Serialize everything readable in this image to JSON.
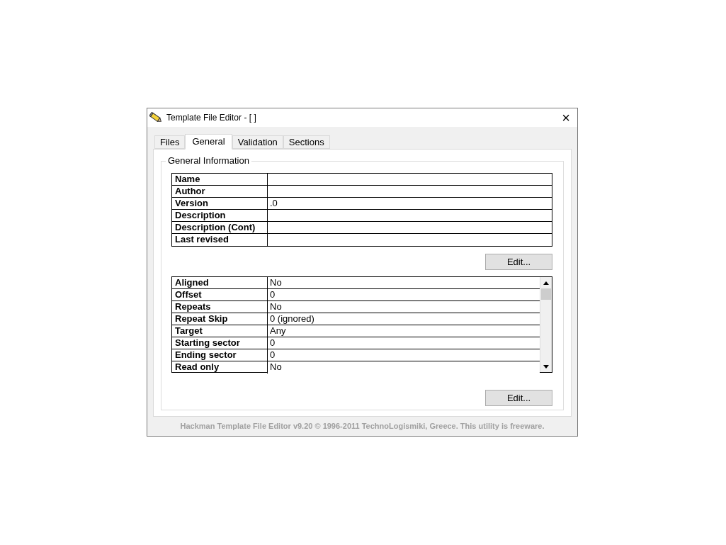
{
  "window": {
    "title": "Template File Editor - [ ]",
    "close": "×"
  },
  "tabs": [
    {
      "label": "Files",
      "selected": false
    },
    {
      "label": "General",
      "selected": true
    },
    {
      "label": "Validation",
      "selected": false
    },
    {
      "label": "Sections",
      "selected": false
    }
  ],
  "group": {
    "title": "General Information"
  },
  "info_table": [
    {
      "label": "Name"
    },
    {
      "label": "Author"
    },
    {
      "label": "Version",
      "value": ".0"
    },
    {
      "label": "Description"
    },
    {
      "label": "Description (Cont)"
    },
    {
      "label": "Last revised"
    }
  ],
  "info_edit_button": "Edit...",
  "properties_table": [
    {
      "label": "Aligned",
      "value": "No"
    },
    {
      "label": "Offset",
      "value": "0"
    },
    {
      "label": "Repeats",
      "value": "No"
    },
    {
      "label": "Repeat Skip",
      "value": "0 (ignored)"
    },
    {
      "label": "Target",
      "value": "Any"
    },
    {
      "label": "Starting sector",
      "value": "0"
    },
    {
      "label": "Ending sector",
      "value": "0"
    },
    {
      "label": "Read only",
      "value": "No"
    }
  ],
  "properties_edit_button": "Edit...",
  "footer": "Hackman Template File Editor v9.20 © 1996-2011 TechnoLogismiki, Greece. This utility is freeware."
}
